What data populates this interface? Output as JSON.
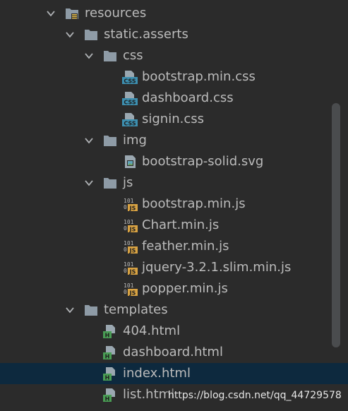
{
  "tree": [
    {
      "label": "resources",
      "icon": "resources-folder-icon"
    },
    {
      "label": "static.asserts",
      "icon": "folder-icon"
    },
    {
      "label": "css",
      "icon": "folder-icon"
    },
    {
      "label": "bootstrap.min.css",
      "icon": "css-file-icon"
    },
    {
      "label": "dashboard.css",
      "icon": "css-file-icon"
    },
    {
      "label": "signin.css",
      "icon": "css-file-icon"
    },
    {
      "label": "img",
      "icon": "folder-icon"
    },
    {
      "label": "bootstrap-solid.svg",
      "icon": "image-file-icon"
    },
    {
      "label": "js",
      "icon": "folder-icon"
    },
    {
      "label": "bootstrap.min.js",
      "icon": "js-file-icon"
    },
    {
      "label": "Chart.min.js",
      "icon": "js-file-icon"
    },
    {
      "label": "feather.min.js",
      "icon": "js-file-icon"
    },
    {
      "label": "jquery-3.2.1.slim.min.js",
      "icon": "js-file-icon"
    },
    {
      "label": "popper.min.js",
      "icon": "js-file-icon"
    },
    {
      "label": "templates",
      "icon": "folder-icon"
    },
    {
      "label": "404.html",
      "icon": "html-file-icon"
    },
    {
      "label": "dashboard.html",
      "icon": "html-file-icon"
    },
    {
      "label": "index.html",
      "icon": "html-file-icon",
      "selected": true
    },
    {
      "label": "list.html",
      "icon": "html-file-icon"
    }
  ],
  "watermark": "https://blog.csdn.net/qq_44729578",
  "colors": {
    "background": "#2b2b2b",
    "text": "#bbbbbb",
    "selection": "#0d293e",
    "folder": "#8e9ba6",
    "css_badge": "#3d8fb0",
    "js_badge": "#d9a343",
    "html_badge": "#499c54"
  }
}
